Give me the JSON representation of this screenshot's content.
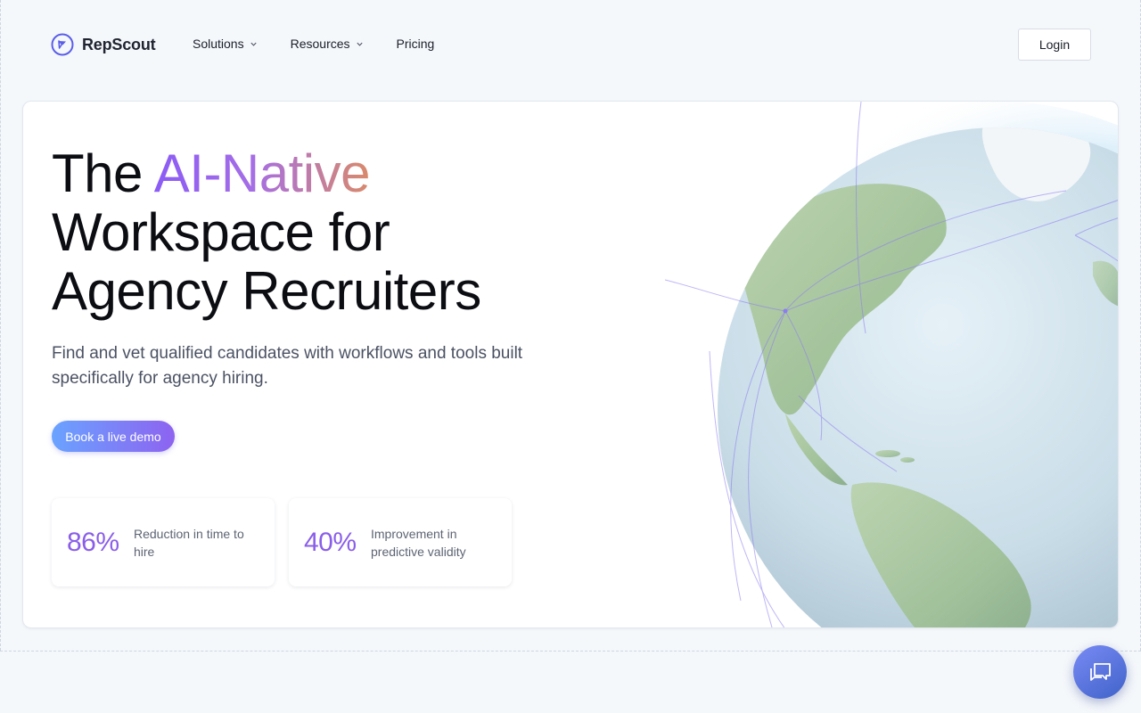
{
  "brand": {
    "name": "RepScout",
    "logo_icon": "compass-icon",
    "accent": "#6366f1"
  },
  "nav": {
    "items": [
      {
        "label": "Solutions",
        "has_dropdown": true
      },
      {
        "label": "Resources",
        "has_dropdown": true
      },
      {
        "label": "Pricing",
        "has_dropdown": false
      }
    ],
    "login_label": "Login"
  },
  "hero": {
    "title_prefix": "The ",
    "title_highlight": "AI-Native",
    "title_line2": "Workspace for",
    "title_line3": "Agency Recruiters",
    "subtitle": "Find and vet qualified candidates with workflows and tools built specifically for agency hiring.",
    "cta_label": "Book a live demo",
    "highlight_gradient": [
      "#8b5cf6",
      "#d98a6a"
    ],
    "cta_gradient": [
      "#6aa3ff",
      "#8d63f0"
    ]
  },
  "stats": [
    {
      "value": "86%",
      "label": "Reduction in time to hire"
    },
    {
      "value": "40%",
      "label": "Improvement in predictive validity"
    }
  ],
  "chat": {
    "icon": "chat-bubbles-icon"
  }
}
